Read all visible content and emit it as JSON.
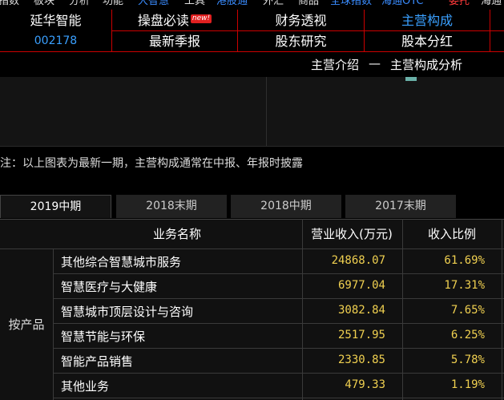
{
  "menu": [
    {
      "label": "指数",
      "color": "default"
    },
    {
      "label": "板块",
      "color": "default"
    },
    {
      "label": "分析",
      "color": "default"
    },
    {
      "label": "功能",
      "color": "default"
    },
    {
      "label": "大智慧",
      "color": "blue"
    },
    {
      "label": "工具",
      "color": "default"
    },
    {
      "label": "港股通",
      "color": "blue"
    },
    {
      "label": "外汇",
      "color": "default"
    },
    {
      "label": "商品",
      "color": "default"
    },
    {
      "label": "全球指数",
      "color": "blue"
    },
    {
      "label": "海通OTC",
      "color": "blue"
    },
    {
      "label": "委托",
      "color": "red"
    },
    {
      "label": "海通",
      "color": "default"
    }
  ],
  "stock": {
    "name": "延华智能",
    "code": "002178"
  },
  "nav": {
    "row1": [
      "操盘必读",
      "财务透视",
      "主营构成"
    ],
    "row2": [
      "最新季报",
      "股东研究",
      "股本分红"
    ],
    "badge": "new!",
    "active": "主营构成"
  },
  "subnav": {
    "left": "主营介绍",
    "sep": "—",
    "right": "主营构成分析"
  },
  "note": "注：以上图表为最新一期，主营构成通常在中报、年报时披露",
  "tabs": [
    "2019中期",
    "2018末期",
    "2018中期",
    "2017末期"
  ],
  "table": {
    "headers": {
      "name": "业务名称",
      "revenue": "营业收入(万元)",
      "ratio": "收入比例"
    },
    "category": "按产品",
    "rows": [
      {
        "name": "其他综合智慧城市服务",
        "revenue": "24868.07",
        "ratio": "61.69%"
      },
      {
        "name": "智慧医疗与大健康",
        "revenue": "6977.04",
        "ratio": "17.31%"
      },
      {
        "name": "智慧城市顶层设计与咨询",
        "revenue": "3082.84",
        "ratio": "7.65%"
      },
      {
        "name": "智慧节能与环保",
        "revenue": "2517.95",
        "ratio": "6.25%"
      },
      {
        "name": "智能产品销售",
        "revenue": "2330.85",
        "ratio": "5.78%"
      },
      {
        "name": "其他业务",
        "revenue": "479.33",
        "ratio": "1.19%"
      }
    ]
  }
}
